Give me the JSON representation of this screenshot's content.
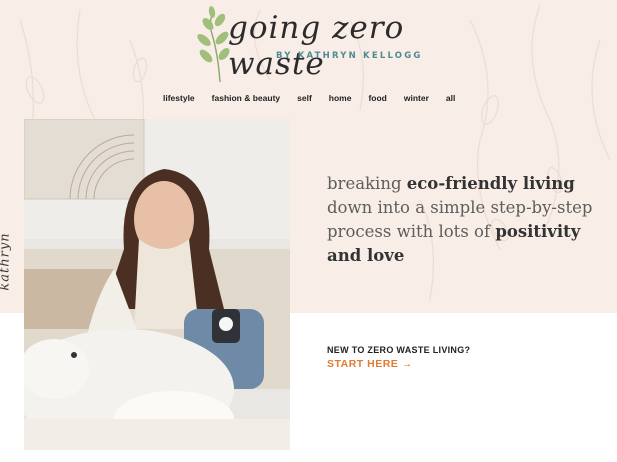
{
  "logo": {
    "title": "going zero waste",
    "byline": "BY KATHRYN KELLOGG",
    "sprig_icon": "leaf-sprig-icon"
  },
  "nav": {
    "items": [
      "lifestyle",
      "fashion & beauty",
      "self",
      "home",
      "food",
      "winter",
      "all"
    ]
  },
  "hero": {
    "signature": "kathryn",
    "photo_alt": "woman smiling on couch with white dog and penguin mug",
    "tagline_parts": [
      "breaking ",
      "eco-friendly living",
      " down into a simple step-by-step process with lots of ",
      "positivity and love"
    ],
    "cta_question": "NEW TO ZERO WASTE LIVING?",
    "cta_label": "START HERE",
    "cta_arrow": "→"
  },
  "colors": {
    "band": "#f9ede7",
    "accent": "#e07b31",
    "byline": "#4f8a93",
    "text": "#222222"
  }
}
